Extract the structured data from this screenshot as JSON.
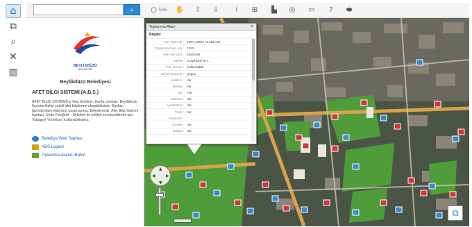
{
  "search": {
    "placeholder": "",
    "button_icon": "search-icon"
  },
  "left_tools": [
    {
      "name": "home-icon",
      "glyph": "⌂"
    },
    {
      "name": "layers-icon",
      "glyph": "⧉"
    },
    {
      "name": "search-icon",
      "glyph": "⌕"
    },
    {
      "name": "tools-icon",
      "glyph": "✕"
    },
    {
      "name": "barcode-icon",
      "glyph": "▥"
    }
  ],
  "toolbar": {
    "clear_label": "Temi",
    "items": [
      {
        "name": "pan-hand-icon",
        "glyph": "✋"
      },
      {
        "name": "zoom-in-icon",
        "glyph": "⇧"
      },
      {
        "name": "zoom-out-icon",
        "glyph": "⇩"
      },
      {
        "name": "info-icon",
        "glyph": "i"
      },
      {
        "name": "coordinate-icon",
        "glyph": "⊞"
      },
      {
        "name": "building-icon",
        "glyph": "▙"
      },
      {
        "name": "globe-icon",
        "glyph": "◎"
      },
      {
        "name": "print-icon",
        "glyph": "▭"
      },
      {
        "name": "help-icon",
        "glyph": "?"
      },
      {
        "name": "measure-icon",
        "glyph": "⬬"
      }
    ]
  },
  "panel": {
    "logo_name": "BEYLİKDÜZÜ",
    "logo_sub": "BELEDİYESİ",
    "title": "Beylikdüzü Belediyesi",
    "heading": "AFET BİLGİ SİSTEMİ (A.B.S.)",
    "body": "AFET BİLGİ SİSTEMİ'ne Hoş Geldiniz. Harita ücretsiz. Beylikdüzü İlçesine ilişkin çeşitli afet bilgilerine ulaşabilirsiniz. Sayfayı favorilerinize eklemeyi unutmayınız. Belediyemiz: Afet Bilgi Sistemi haritası. Uydu Fotoğrafı - Ortofoto ile birlikte inceleyebilmek için 'Katagori Yöneticisi' kullanabilirsiniz.",
    "links": [
      {
        "label": "Belediye Web Sayfası",
        "icon": "globe-link-icon",
        "color": "#2a7fd0"
      },
      {
        "label": "ABS Lejand",
        "icon": "legend-icon",
        "color": "#d9a21a"
      },
      {
        "label": "Toplanma Alanını Bulun",
        "icon": "map-link-icon",
        "color": "#6a9f3a"
      }
    ]
  },
  "popup": {
    "title": "Toplanma Alanı",
    "section": "Bilgiler",
    "rows": [
      {
        "k": "Afet Türü Adı :",
        "v": "TOPLANMA ALANLARI"
      },
      {
        "k": "Toplanma Alan. Adı :",
        "v": "F223"
      },
      {
        "k": "Net Alan (m²) :",
        "v": "34624.68"
      },
      {
        "k": "Mahal :",
        "v": "CUMHURİYET..."
      },
      {
        "k": "Pol. Durum :",
        "v": "Kullanılabilir"
      },
      {
        "k": "Zemin Durumu :",
        "v": "Uygun"
      },
      {
        "k": "Helikam :",
        "v": "Var"
      },
      {
        "k": "Mutfak :",
        "v": "Var"
      },
      {
        "k": "Sel :",
        "v": "Yok"
      },
      {
        "k": "Kamara :",
        "v": "Var"
      },
      {
        "k": "Aydınlatma :",
        "v": "Var"
      },
      {
        "k": "Trafo :",
        "v": "Var"
      },
      {
        "k": "Jeneratör :",
        "v": ""
      },
      {
        "k": "Tuvalet :",
        "v": "Var"
      },
      {
        "k": "Banyo :",
        "v": "Var"
      }
    ]
  },
  "scale": "",
  "colors": {
    "accent": "#2a8ad8",
    "road": "#d9a24a",
    "grass": "#4f9c3a",
    "marker_red": "#d9313a",
    "marker_blue": "#3a89d0"
  }
}
